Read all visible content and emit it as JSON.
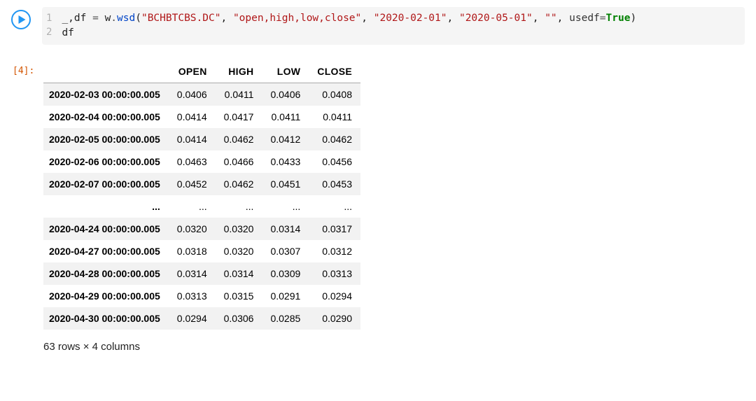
{
  "code": {
    "line_nums": [
      "1",
      "2"
    ],
    "tokens_line1": {
      "pre_assign": "_,df ",
      "eq": "= ",
      "obj": "w",
      "dot": ".",
      "func": "wsd",
      "open": "(",
      "s1": "\"BCHBTCBS.DC\"",
      "c1": ", ",
      "s2": "\"open,high,low,close\"",
      "c2": ", ",
      "s3": "\"2020-02-01\"",
      "c3": ", ",
      "s4": "\"2020-05-01\"",
      "c4": ", ",
      "s5": "\"\"",
      "c5": ", ",
      "kw": "usedf",
      "kweq": "=",
      "true": "True",
      "close": ")"
    },
    "line2": "df"
  },
  "output": {
    "prompt": "[4]:",
    "columns": [
      "OPEN",
      "HIGH",
      "LOW",
      "CLOSE"
    ],
    "rows": [
      {
        "idx": "2020-02-03 00:00:00.005",
        "cells": [
          "0.0406",
          "0.0411",
          "0.0406",
          "0.0408"
        ]
      },
      {
        "idx": "2020-02-04 00:00:00.005",
        "cells": [
          "0.0414",
          "0.0417",
          "0.0411",
          "0.0411"
        ]
      },
      {
        "idx": "2020-02-05 00:00:00.005",
        "cells": [
          "0.0414",
          "0.0462",
          "0.0412",
          "0.0462"
        ]
      },
      {
        "idx": "2020-02-06 00:00:00.005",
        "cells": [
          "0.0463",
          "0.0466",
          "0.0433",
          "0.0456"
        ]
      },
      {
        "idx": "2020-02-07 00:00:00.005",
        "cells": [
          "0.0452",
          "0.0462",
          "0.0451",
          "0.0453"
        ]
      },
      {
        "idx": "...",
        "cells": [
          "...",
          "...",
          "...",
          "..."
        ]
      },
      {
        "idx": "2020-04-24 00:00:00.005",
        "cells": [
          "0.0320",
          "0.0320",
          "0.0314",
          "0.0317"
        ]
      },
      {
        "idx": "2020-04-27 00:00:00.005",
        "cells": [
          "0.0318",
          "0.0320",
          "0.0307",
          "0.0312"
        ]
      },
      {
        "idx": "2020-04-28 00:00:00.005",
        "cells": [
          "0.0314",
          "0.0314",
          "0.0309",
          "0.0313"
        ]
      },
      {
        "idx": "2020-04-29 00:00:00.005",
        "cells": [
          "0.0313",
          "0.0315",
          "0.0291",
          "0.0294"
        ]
      },
      {
        "idx": "2020-04-30 00:00:00.005",
        "cells": [
          "0.0294",
          "0.0306",
          "0.0285",
          "0.0290"
        ]
      }
    ],
    "footer": "63 rows × 4 columns"
  }
}
